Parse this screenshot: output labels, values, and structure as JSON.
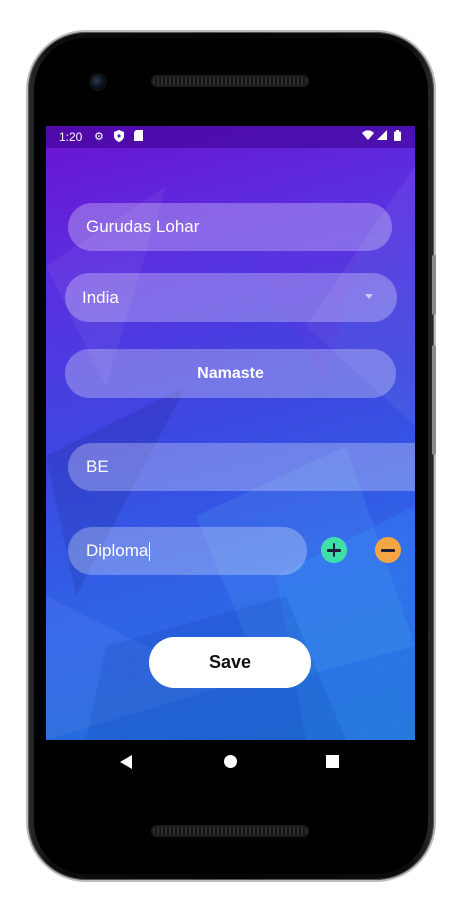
{
  "status_bar": {
    "time": "1:20",
    "left_icons": [
      "gear-icon",
      "shield-icon",
      "sd-card-icon"
    ],
    "right_icons": [
      "wifi-icon",
      "signal-icon",
      "battery-icon"
    ]
  },
  "form": {
    "name_value": "Gurudas Lohar",
    "country_value": "India",
    "greeting_button_label": "Namaste",
    "qualification_1_value": "BE",
    "qualification_2_value": "Diploma",
    "save_label": "Save"
  },
  "colors": {
    "add_button": "#3fe0a8",
    "remove_button": "#f6a544",
    "background_top": "#6a12cf",
    "background_bottom": "#1f6fd6"
  },
  "nav_bar": {
    "icons": [
      "back-icon",
      "home-icon",
      "recents-icon"
    ]
  }
}
